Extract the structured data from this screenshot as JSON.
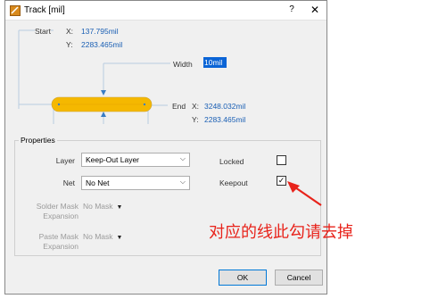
{
  "window": {
    "title": "Track [mil]",
    "help": "?",
    "close": "✕"
  },
  "diagram": {
    "start_label": "Start",
    "end_label": "End",
    "width_label": "Width",
    "x_label": "X:",
    "y_label": "Y:",
    "start_x": "137.795mil",
    "start_y": "2283.465mil",
    "width_value": "10mil",
    "end_x": "3248.032mil",
    "end_y": "2283.465mil",
    "track_color": "#f5b800"
  },
  "properties": {
    "group_title": "Properties",
    "layer_label": "Layer",
    "layer_value": "Keep-Out Layer",
    "net_label": "Net",
    "net_value": "No Net",
    "locked_label": "Locked",
    "keepout_label": "Keepout",
    "locked_checked": false,
    "keepout_checked": true,
    "solder_mask_label_1": "Solder Mask",
    "solder_mask_label_2": "Expansion",
    "solder_mask_value": "No Mask",
    "paste_mask_label_1": "Paste Mask",
    "paste_mask_label_2": "Expansion",
    "paste_mask_value": "No Mask"
  },
  "buttons": {
    "ok": "OK",
    "cancel": "Cancel"
  },
  "annotation": {
    "text": "对应的线此勾请去掉",
    "color": "#e8231b"
  }
}
